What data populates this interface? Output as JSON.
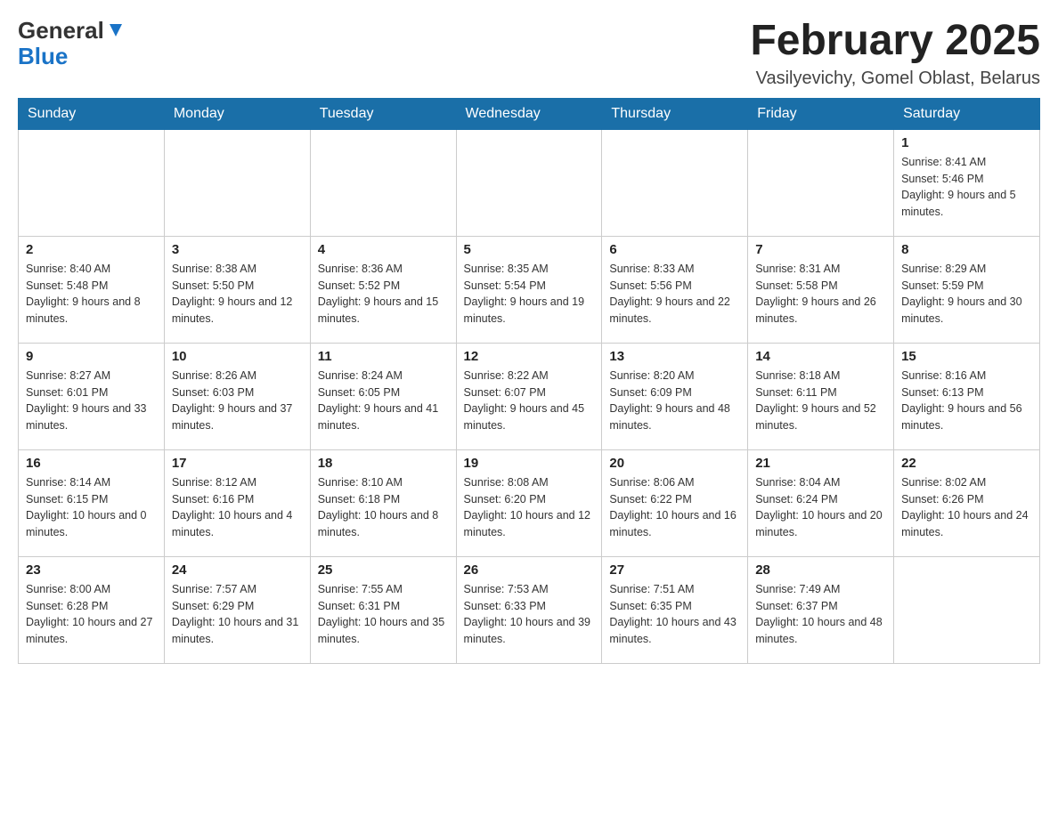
{
  "header": {
    "logo_general": "General",
    "logo_blue": "Blue",
    "title": "February 2025",
    "location": "Vasilyevichy, Gomel Oblast, Belarus"
  },
  "weekdays": [
    "Sunday",
    "Monday",
    "Tuesday",
    "Wednesday",
    "Thursday",
    "Friday",
    "Saturday"
  ],
  "weeks": [
    [
      {
        "day": "",
        "info": ""
      },
      {
        "day": "",
        "info": ""
      },
      {
        "day": "",
        "info": ""
      },
      {
        "day": "",
        "info": ""
      },
      {
        "day": "",
        "info": ""
      },
      {
        "day": "",
        "info": ""
      },
      {
        "day": "1",
        "info": "Sunrise: 8:41 AM\nSunset: 5:46 PM\nDaylight: 9 hours and 5 minutes."
      }
    ],
    [
      {
        "day": "2",
        "info": "Sunrise: 8:40 AM\nSunset: 5:48 PM\nDaylight: 9 hours and 8 minutes."
      },
      {
        "day": "3",
        "info": "Sunrise: 8:38 AM\nSunset: 5:50 PM\nDaylight: 9 hours and 12 minutes."
      },
      {
        "day": "4",
        "info": "Sunrise: 8:36 AM\nSunset: 5:52 PM\nDaylight: 9 hours and 15 minutes."
      },
      {
        "day": "5",
        "info": "Sunrise: 8:35 AM\nSunset: 5:54 PM\nDaylight: 9 hours and 19 minutes."
      },
      {
        "day": "6",
        "info": "Sunrise: 8:33 AM\nSunset: 5:56 PM\nDaylight: 9 hours and 22 minutes."
      },
      {
        "day": "7",
        "info": "Sunrise: 8:31 AM\nSunset: 5:58 PM\nDaylight: 9 hours and 26 minutes."
      },
      {
        "day": "8",
        "info": "Sunrise: 8:29 AM\nSunset: 5:59 PM\nDaylight: 9 hours and 30 minutes."
      }
    ],
    [
      {
        "day": "9",
        "info": "Sunrise: 8:27 AM\nSunset: 6:01 PM\nDaylight: 9 hours and 33 minutes."
      },
      {
        "day": "10",
        "info": "Sunrise: 8:26 AM\nSunset: 6:03 PM\nDaylight: 9 hours and 37 minutes."
      },
      {
        "day": "11",
        "info": "Sunrise: 8:24 AM\nSunset: 6:05 PM\nDaylight: 9 hours and 41 minutes."
      },
      {
        "day": "12",
        "info": "Sunrise: 8:22 AM\nSunset: 6:07 PM\nDaylight: 9 hours and 45 minutes."
      },
      {
        "day": "13",
        "info": "Sunrise: 8:20 AM\nSunset: 6:09 PM\nDaylight: 9 hours and 48 minutes."
      },
      {
        "day": "14",
        "info": "Sunrise: 8:18 AM\nSunset: 6:11 PM\nDaylight: 9 hours and 52 minutes."
      },
      {
        "day": "15",
        "info": "Sunrise: 8:16 AM\nSunset: 6:13 PM\nDaylight: 9 hours and 56 minutes."
      }
    ],
    [
      {
        "day": "16",
        "info": "Sunrise: 8:14 AM\nSunset: 6:15 PM\nDaylight: 10 hours and 0 minutes."
      },
      {
        "day": "17",
        "info": "Sunrise: 8:12 AM\nSunset: 6:16 PM\nDaylight: 10 hours and 4 minutes."
      },
      {
        "day": "18",
        "info": "Sunrise: 8:10 AM\nSunset: 6:18 PM\nDaylight: 10 hours and 8 minutes."
      },
      {
        "day": "19",
        "info": "Sunrise: 8:08 AM\nSunset: 6:20 PM\nDaylight: 10 hours and 12 minutes."
      },
      {
        "day": "20",
        "info": "Sunrise: 8:06 AM\nSunset: 6:22 PM\nDaylight: 10 hours and 16 minutes."
      },
      {
        "day": "21",
        "info": "Sunrise: 8:04 AM\nSunset: 6:24 PM\nDaylight: 10 hours and 20 minutes."
      },
      {
        "day": "22",
        "info": "Sunrise: 8:02 AM\nSunset: 6:26 PM\nDaylight: 10 hours and 24 minutes."
      }
    ],
    [
      {
        "day": "23",
        "info": "Sunrise: 8:00 AM\nSunset: 6:28 PM\nDaylight: 10 hours and 27 minutes."
      },
      {
        "day": "24",
        "info": "Sunrise: 7:57 AM\nSunset: 6:29 PM\nDaylight: 10 hours and 31 minutes."
      },
      {
        "day": "25",
        "info": "Sunrise: 7:55 AM\nSunset: 6:31 PM\nDaylight: 10 hours and 35 minutes."
      },
      {
        "day": "26",
        "info": "Sunrise: 7:53 AM\nSunset: 6:33 PM\nDaylight: 10 hours and 39 minutes."
      },
      {
        "day": "27",
        "info": "Sunrise: 7:51 AM\nSunset: 6:35 PM\nDaylight: 10 hours and 43 minutes."
      },
      {
        "day": "28",
        "info": "Sunrise: 7:49 AM\nSunset: 6:37 PM\nDaylight: 10 hours and 48 minutes."
      },
      {
        "day": "",
        "info": ""
      }
    ]
  ]
}
